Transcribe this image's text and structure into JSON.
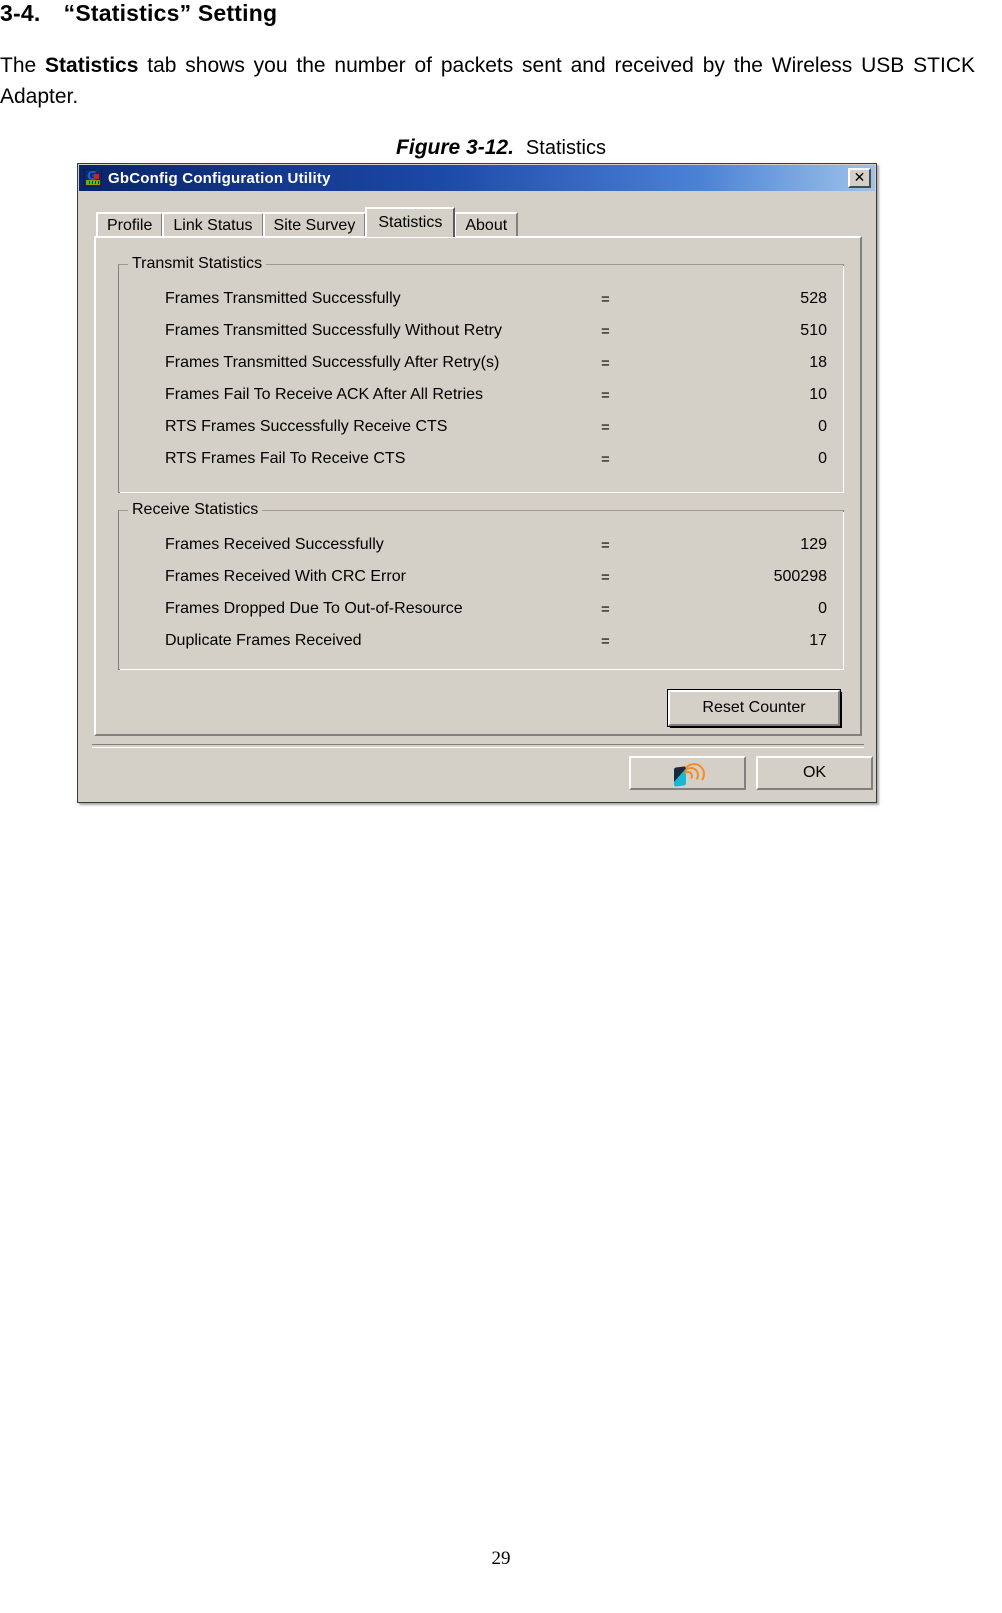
{
  "document": {
    "section_heading": "3-4. “Statistics” Setting",
    "paragraph_pre": "The ",
    "paragraph_bold": "Statistics",
    "paragraph_post": " tab shows you the number of packets sent and received by the Wireless USB STICK Adapter.",
    "figure_number": "Figure 3-12.",
    "figure_title": "Statistics",
    "page_number": "29"
  },
  "dialog": {
    "title": "GbConfig Configuration Utility",
    "close_label": "✕",
    "tabs": [
      {
        "label": "Profile",
        "active": false
      },
      {
        "label": "Link Status",
        "active": false
      },
      {
        "label": "Site Survey",
        "active": false
      },
      {
        "label": "Statistics",
        "active": true
      },
      {
        "label": "About",
        "active": false
      }
    ],
    "transmit_group": {
      "legend": "Transmit Statistics",
      "rows": [
        {
          "label": "Frames Transmitted Successfully",
          "eq": "=",
          "value": "528"
        },
        {
          "label": "Frames Transmitted Successfully  Without Retry",
          "eq": "=",
          "value": "510"
        },
        {
          "label": "Frames Transmitted Successfully After Retry(s)",
          "eq": "=",
          "value": "18"
        },
        {
          "label": "Frames Fail To Receive ACK After All Retries",
          "eq": "=",
          "value": "10"
        },
        {
          "label": "RTS Frames Successfully Receive CTS",
          "eq": "=",
          "value": "0"
        },
        {
          "label": "RTS Frames Fail To Receive CTS",
          "eq": "=",
          "value": "0"
        }
      ]
    },
    "receive_group": {
      "legend": "Receive Statistics",
      "rows": [
        {
          "label": "Frames Received Successfully",
          "eq": "=",
          "value": "129"
        },
        {
          "label": "Frames Received With CRC Error",
          "eq": "=",
          "value": "500298"
        },
        {
          "label": "Frames Dropped Due To Out-of-Resource",
          "eq": "=",
          "value": "0"
        },
        {
          "label": "Duplicate Frames Received",
          "eq": "=",
          "value": "17"
        }
      ]
    },
    "buttons": {
      "reset_counter": "Reset Counter",
      "ok": "OK",
      "wireless_icon_name": "wireless-signal-icon"
    },
    "colors": {
      "face": "#d4d0c8",
      "titlebar_start": "#0a246a",
      "titlebar_end": "#9fc2ea",
      "icon_orange": "#f68b1f",
      "icon_teal": "#19b9d4"
    }
  }
}
